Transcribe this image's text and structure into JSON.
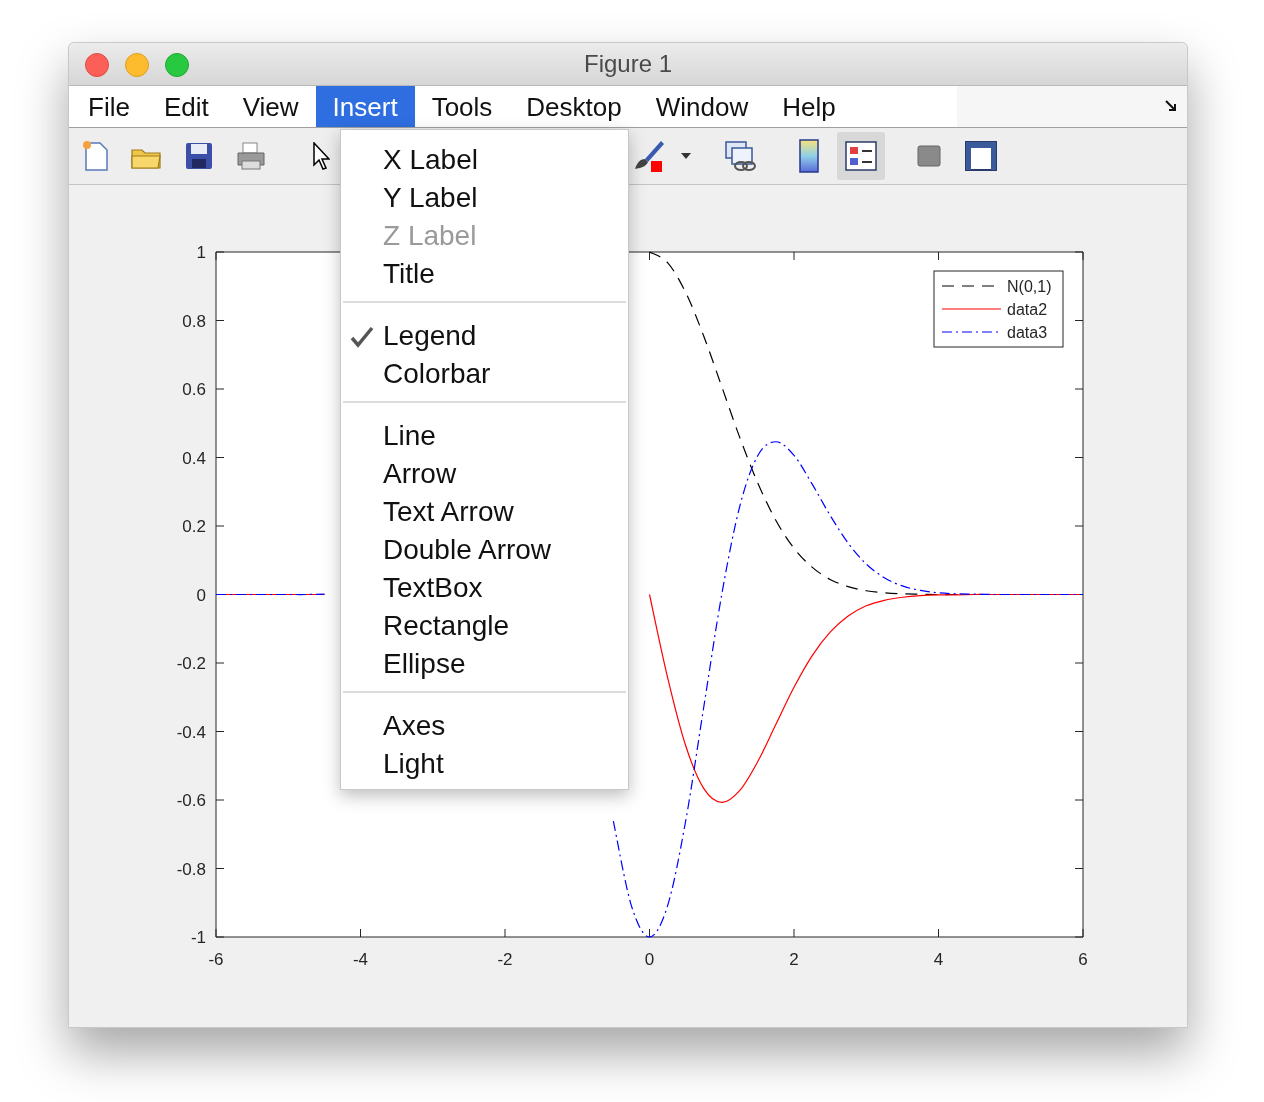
{
  "window": {
    "title": "Figure 1"
  },
  "menubar": [
    {
      "label": "File",
      "selected": false
    },
    {
      "label": "Edit",
      "selected": false
    },
    {
      "label": "View",
      "selected": false
    },
    {
      "label": "Insert",
      "selected": true
    },
    {
      "label": "Tools",
      "selected": false
    },
    {
      "label": "Desktop",
      "selected": false
    },
    {
      "label": "Window",
      "selected": false
    },
    {
      "label": "Help",
      "selected": false
    }
  ],
  "toolbar": [
    {
      "kind": "new",
      "pressed": false
    },
    {
      "kind": "open",
      "pressed": false
    },
    {
      "kind": "save",
      "pressed": false
    },
    {
      "kind": "print",
      "pressed": false
    },
    {
      "kind": "pointer",
      "pressed": false
    },
    {
      "kind": "brush",
      "pressed": false
    },
    {
      "kind": "caret",
      "pressed": false
    },
    {
      "kind": "link",
      "pressed": false
    },
    {
      "kind": "colorbar",
      "pressed": false
    },
    {
      "kind": "legend",
      "pressed": true
    },
    {
      "kind": "hide",
      "pressed": false
    },
    {
      "kind": "show",
      "pressed": false
    }
  ],
  "insert_menu": [
    [
      {
        "label": "X Label",
        "checked": false,
        "disabled": false
      },
      {
        "label": "Y Label",
        "checked": false,
        "disabled": false
      },
      {
        "label": "Z Label",
        "checked": false,
        "disabled": true
      },
      {
        "label": "Title",
        "checked": false,
        "disabled": false
      }
    ],
    [
      {
        "label": "Legend",
        "checked": true,
        "disabled": false
      },
      {
        "label": "Colorbar",
        "checked": false,
        "disabled": false
      }
    ],
    [
      {
        "label": "Line",
        "checked": false,
        "disabled": false
      },
      {
        "label": "Arrow",
        "checked": false,
        "disabled": false
      },
      {
        "label": "Text Arrow",
        "checked": false,
        "disabled": false
      },
      {
        "label": "Double Arrow",
        "checked": false,
        "disabled": false
      },
      {
        "label": "TextBox",
        "checked": false,
        "disabled": false
      },
      {
        "label": "Rectangle",
        "checked": false,
        "disabled": false
      },
      {
        "label": "Ellipse",
        "checked": false,
        "disabled": false
      }
    ],
    [
      {
        "label": "Axes",
        "checked": false,
        "disabled": false
      },
      {
        "label": "Light",
        "checked": false,
        "disabled": false
      }
    ]
  ],
  "figure": {
    "chart_data": {
      "type": "line",
      "xlim": [
        -6,
        6
      ],
      "ylim": [
        -1,
        1
      ],
      "xticks": [
        -6,
        -4,
        -2,
        0,
        2,
        4,
        6
      ],
      "yticks": [
        -1,
        -0.8,
        -0.6,
        -0.4,
        -0.2,
        0,
        0.2,
        0.4,
        0.6,
        0.8,
        1
      ],
      "x": [
        -6,
        -5.75,
        -5.5,
        -5.25,
        -5,
        -4.75,
        -4.5,
        -4.25,
        -4,
        -3.75,
        -3.5,
        -3.25,
        -3,
        -2.75,
        -2.5,
        -2.25,
        -2,
        -1.75,
        -1.5,
        -1.25,
        -1,
        -0.75,
        -0.5,
        -0.25,
        0,
        0.25,
        0.5,
        0.75,
        1,
        1.25,
        1.5,
        1.75,
        2,
        2.25,
        2.5,
        2.75,
        3,
        3.25,
        3.5,
        3.75,
        4,
        4.25,
        4.5,
        4.75,
        5,
        5.25,
        5.5,
        5.75,
        6
      ],
      "legend": true,
      "series": [
        {
          "name": "N(0,1)",
          "color": "#000000",
          "line_style": "dashed",
          "values": [
            0,
            0,
            0,
            0,
            0,
            0,
            0,
            null,
            null,
            null,
            null,
            null,
            null,
            null,
            null,
            null,
            null,
            null,
            null,
            null,
            null,
            null,
            null,
            null,
            1,
            0.969,
            0.882,
            0.755,
            0.607,
            0.458,
            0.325,
            0.216,
            0.135,
            0.08,
            0.044,
            0.023,
            0.011,
            0.005,
            0.002,
            0.001,
            0,
            0,
            0,
            0,
            0,
            0,
            0,
            0,
            0
          ]
        },
        {
          "name": "data2",
          "color": "#ff0000",
          "line_style": "solid",
          "values": [
            0,
            0,
            0,
            0,
            0,
            0,
            0,
            null,
            null,
            null,
            null,
            null,
            null,
            null,
            null,
            null,
            null,
            null,
            null,
            null,
            null,
            null,
            null,
            null,
            0,
            -0.242,
            -0.441,
            -0.566,
            -0.607,
            -0.572,
            -0.487,
            -0.379,
            -0.271,
            -0.179,
            -0.11,
            -0.063,
            -0.033,
            -0.017,
            -0.008,
            -0.003,
            -0.001,
            -0.001,
            0,
            0,
            0,
            0,
            0,
            0,
            0
          ]
        },
        {
          "name": "data3",
          "color": "#0000ff",
          "line_style": "dashdot",
          "values": [
            0,
            0,
            0,
            0,
            0,
            0,
            0.001,
            null,
            null,
            null,
            null,
            null,
            null,
            null,
            null,
            null,
            null,
            null,
            null,
            null,
            null,
            null,
            -0.662,
            -0.909,
            -1,
            -0.909,
            -0.662,
            -0.33,
            0,
            0.258,
            0.406,
            0.446,
            0.406,
            0.323,
            0.231,
            0.15,
            0.089,
            0.049,
            0.025,
            0.012,
            0.005,
            0.002,
            0.001,
            0,
            0,
            0,
            0,
            0,
            0
          ]
        }
      ]
    }
  }
}
